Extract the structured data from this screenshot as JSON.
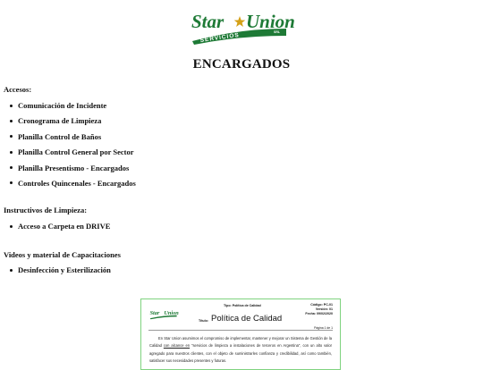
{
  "brand": {
    "logo_text_1": "Star",
    "logo_text_2": "Union",
    "logo_sub": "SERVICIOS",
    "logo_srl": "SRL"
  },
  "title": "ENCARGADOS",
  "sections": [
    {
      "title": "Accesos:",
      "links": [
        "Comunicación de Incidente",
        "Cronograma de Limpieza",
        "Planilla Control de Baños",
        "Planilla Control General por Sector",
        "Planilla Presentismo - Encargados",
        "Controles Quincenales - Encargados"
      ]
    },
    {
      "title": "Instructivos de Limpieza:",
      "links": [
        "Acceso a Carpeta en DRIVE"
      ]
    },
    {
      "title": "Videos y material de Capacitaciones",
      "links": [
        "Desinfección y Esterilización"
      ]
    }
  ],
  "document": {
    "type": "Tipo: Política de Calidad",
    "code": "Código: PC-01",
    "version": "Versión: 01",
    "date": "Fecha: 09/02/2020",
    "page": "Página 1 de 1",
    "label": "Título:",
    "name": "Política de Calidad",
    "body_1": "En Star Union asumimos el compromiso de implementar, mantener y mejorar un Sistema de Gestión de la Calidad ",
    "body_u": "con alcance en",
    "body_2": " \"servicios de limpieza a instalaciones de terceros en Argentina\", con un alto valor agregado para nuestros clientes, con el objeto de suministrarles confianza y credibilidad, así como también, satisfacer sus necesidades presentes y futuras."
  },
  "colors": {
    "brand_green": "#1e7a36",
    "star_gold": "#d4a017",
    "doc_border": "#7fd37f"
  }
}
